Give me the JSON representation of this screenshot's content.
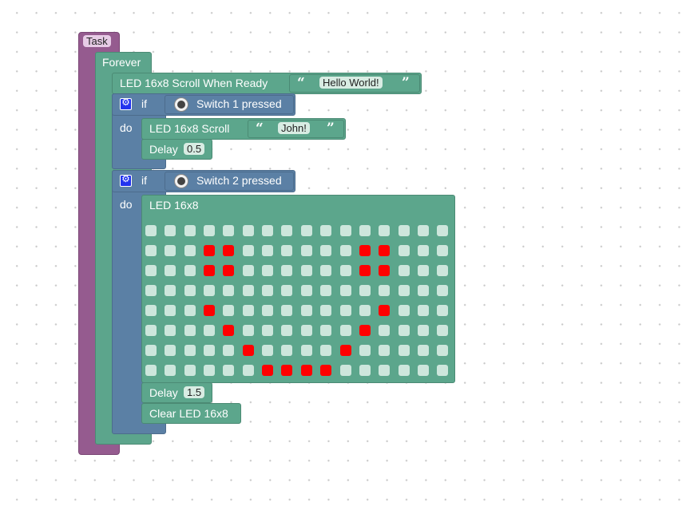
{
  "task": {
    "label": "Task"
  },
  "forever": {
    "label": "Forever"
  },
  "scroll_when_ready": {
    "label": "LED 16x8 Scroll When Ready",
    "text": "Hello World!"
  },
  "if1": {
    "keyword_if": "if",
    "keyword_do": "do",
    "condition": "Switch 1 pressed",
    "scroll": {
      "label": "LED 16x8 Scroll",
      "text": "John!"
    },
    "delay": {
      "label": "Delay",
      "value": "0.5"
    }
  },
  "if2": {
    "keyword_if": "if",
    "keyword_do": "do",
    "condition": "Switch 2 pressed",
    "led": {
      "label": "LED 16x8",
      "cols": 16,
      "rows": 8,
      "on_color": "#ff0000",
      "off_color": "#cde6dc",
      "pixels": [
        "0000000000000000",
        "0001100000011000",
        "0001100000011000",
        "0000000000000000",
        "0001000000001000",
        "0000100000010000",
        "0000010000100000",
        "0000001111000000"
      ]
    },
    "delay": {
      "label": "Delay",
      "value": "1.5"
    },
    "clear": {
      "label": "Clear LED 16x8"
    }
  },
  "colors": {
    "task": "#955b8f",
    "forever": "#5ca58c",
    "logic": "#5b80a5",
    "led": "#5ca68c",
    "background": "#ffffff"
  }
}
